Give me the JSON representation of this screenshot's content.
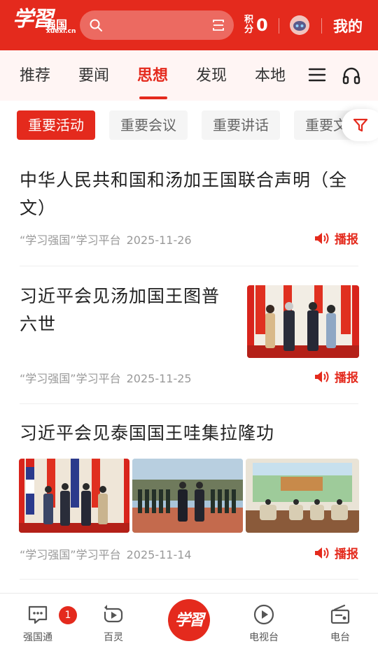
{
  "header": {
    "logo_script": "学習",
    "logo_brand": "强国",
    "logo_domain": "xuexi.cn",
    "points_label": "积分",
    "points_value": "0",
    "mine_label": "我的"
  },
  "channels": [
    {
      "label": "推荐"
    },
    {
      "label": "要闻"
    },
    {
      "label": "思想",
      "active": true
    },
    {
      "label": "发现"
    },
    {
      "label": "本地"
    }
  ],
  "subtabs": [
    {
      "label": "重要活动",
      "active": true
    },
    {
      "label": "重要会议"
    },
    {
      "label": "重要讲话"
    },
    {
      "label": "重要文"
    }
  ],
  "articles": [
    {
      "title": "中华人民共和国和汤加王国联合声明（全文）",
      "source": "“学习强国”学习平台",
      "date": "2025-11-26",
      "broadcast": "播报"
    },
    {
      "title": "习近平会见汤加国王图普六世",
      "source": "“学习强国”学习平台",
      "date": "2025-11-25",
      "broadcast": "播报"
    },
    {
      "title": "习近平会见泰国国王哇集拉隆功",
      "source": "“学习强国”学习平台",
      "date": "2025-11-14",
      "broadcast": "播报"
    }
  ],
  "bottom_nav": [
    {
      "label": "强国通",
      "badge": "1",
      "icon": "chat-bubble-icon"
    },
    {
      "label": "百灵",
      "icon": "refresh-play-icon"
    },
    {
      "label": "学習",
      "icon": "study-logo-icon"
    },
    {
      "label": "电视台",
      "icon": "play-circle-icon"
    },
    {
      "label": "电台",
      "icon": "radio-icon"
    }
  ],
  "colors": {
    "brand_red": "#e42a1d",
    "meta_gray": "#999999"
  }
}
